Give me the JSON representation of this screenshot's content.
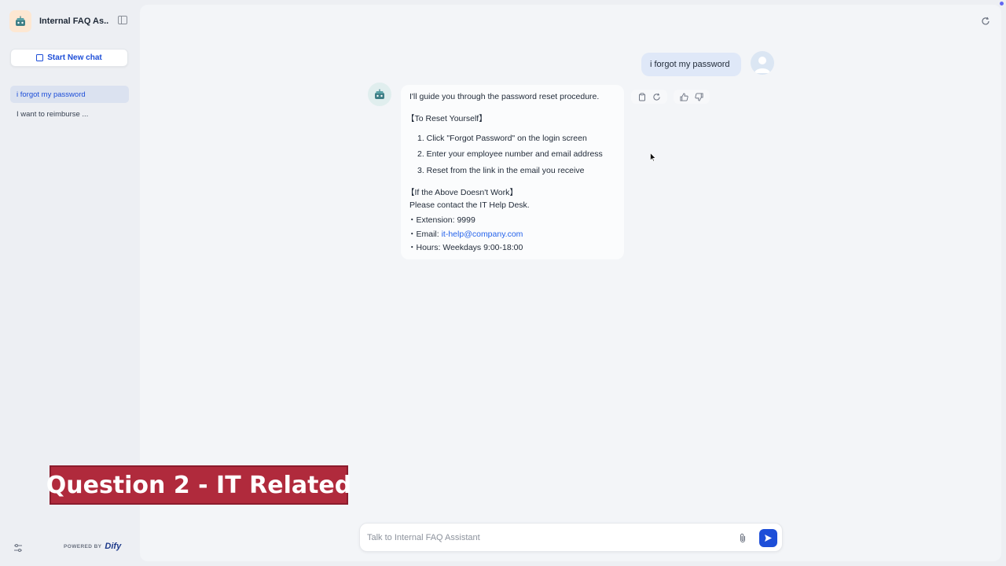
{
  "sidebar": {
    "app_title": "Internal FAQ As...",
    "app_icon": "robot-icon",
    "new_chat_label": "Start New chat",
    "conversations": [
      {
        "label": "i forgot my password",
        "active": true
      },
      {
        "label": "I want to reimburse ...",
        "active": false
      }
    ],
    "powered_by_label": "POWERED BY",
    "powered_by_brand": "Dify"
  },
  "chat": {
    "user_message": "i forgot my password",
    "bot_message": {
      "intro": "I'll guide you through the password reset procedure.",
      "section1_title": "【To Reset Yourself】",
      "steps": [
        "1. Click \"Forgot Password\" on the login screen",
        "2. Enter your employee number and email address",
        "3. Reset from the link in the email you receive"
      ],
      "section2_title": "【If the Above Doesn't Work】",
      "contact_line": "Please contact the IT Help Desk.",
      "extension": "・Extension: 9999",
      "email_prefix": "・Email: ",
      "email": "it-help@company.com",
      "hours": "・Hours: Weekdays 9:00-18:00"
    },
    "actions": [
      "copy-icon",
      "regenerate-icon",
      "thumbs-up-icon",
      "thumbs-down-icon"
    ]
  },
  "input": {
    "placeholder": "Talk to Internal FAQ Assistant",
    "value": ""
  },
  "overlay": {
    "caption": "Question 2 - IT Related"
  },
  "colors": {
    "accent": "#1d4ed8",
    "banner": "#b02a3c",
    "user_bubble": "#dfe8f8"
  }
}
